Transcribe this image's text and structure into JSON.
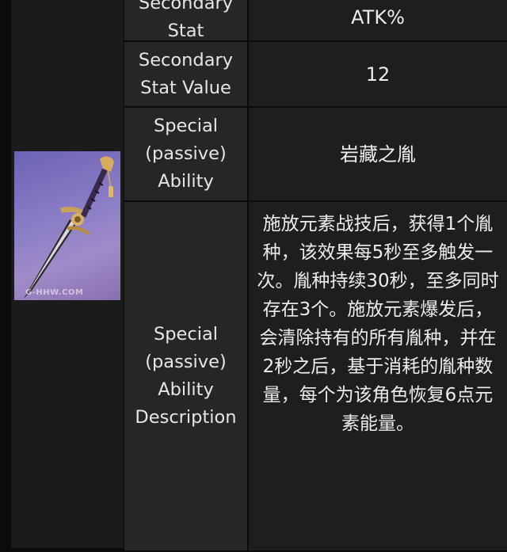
{
  "rows": [
    {
      "label": "Secondary\nStat",
      "value": "ATK%"
    },
    {
      "label": "Secondary\nStat Value",
      "value": "12"
    },
    {
      "label": "Special\n(passive)\nAbility",
      "value": "岩藏之胤"
    },
    {
      "label": "Special\n(passive)\nAbility\nDescription",
      "value": "施放元素战技后，获得1个胤种，该效果每5秒至多触发一次。胤种持续30秒，至多同时存在3个。施放元素爆发后，会清除持有的所有胤种，并在2秒之后，基于消耗的胤种数量，每个为该角色恢复6点元素能量。"
    }
  ],
  "thumbnail": {
    "watermark": "G-HHW.COM",
    "icon": "sword-icon"
  },
  "colors": {
    "background": "#0b0b0b",
    "label_cell": "#262626",
    "value_cell": "#1e1e1e",
    "thumb_bg": "#8b7ec6"
  }
}
